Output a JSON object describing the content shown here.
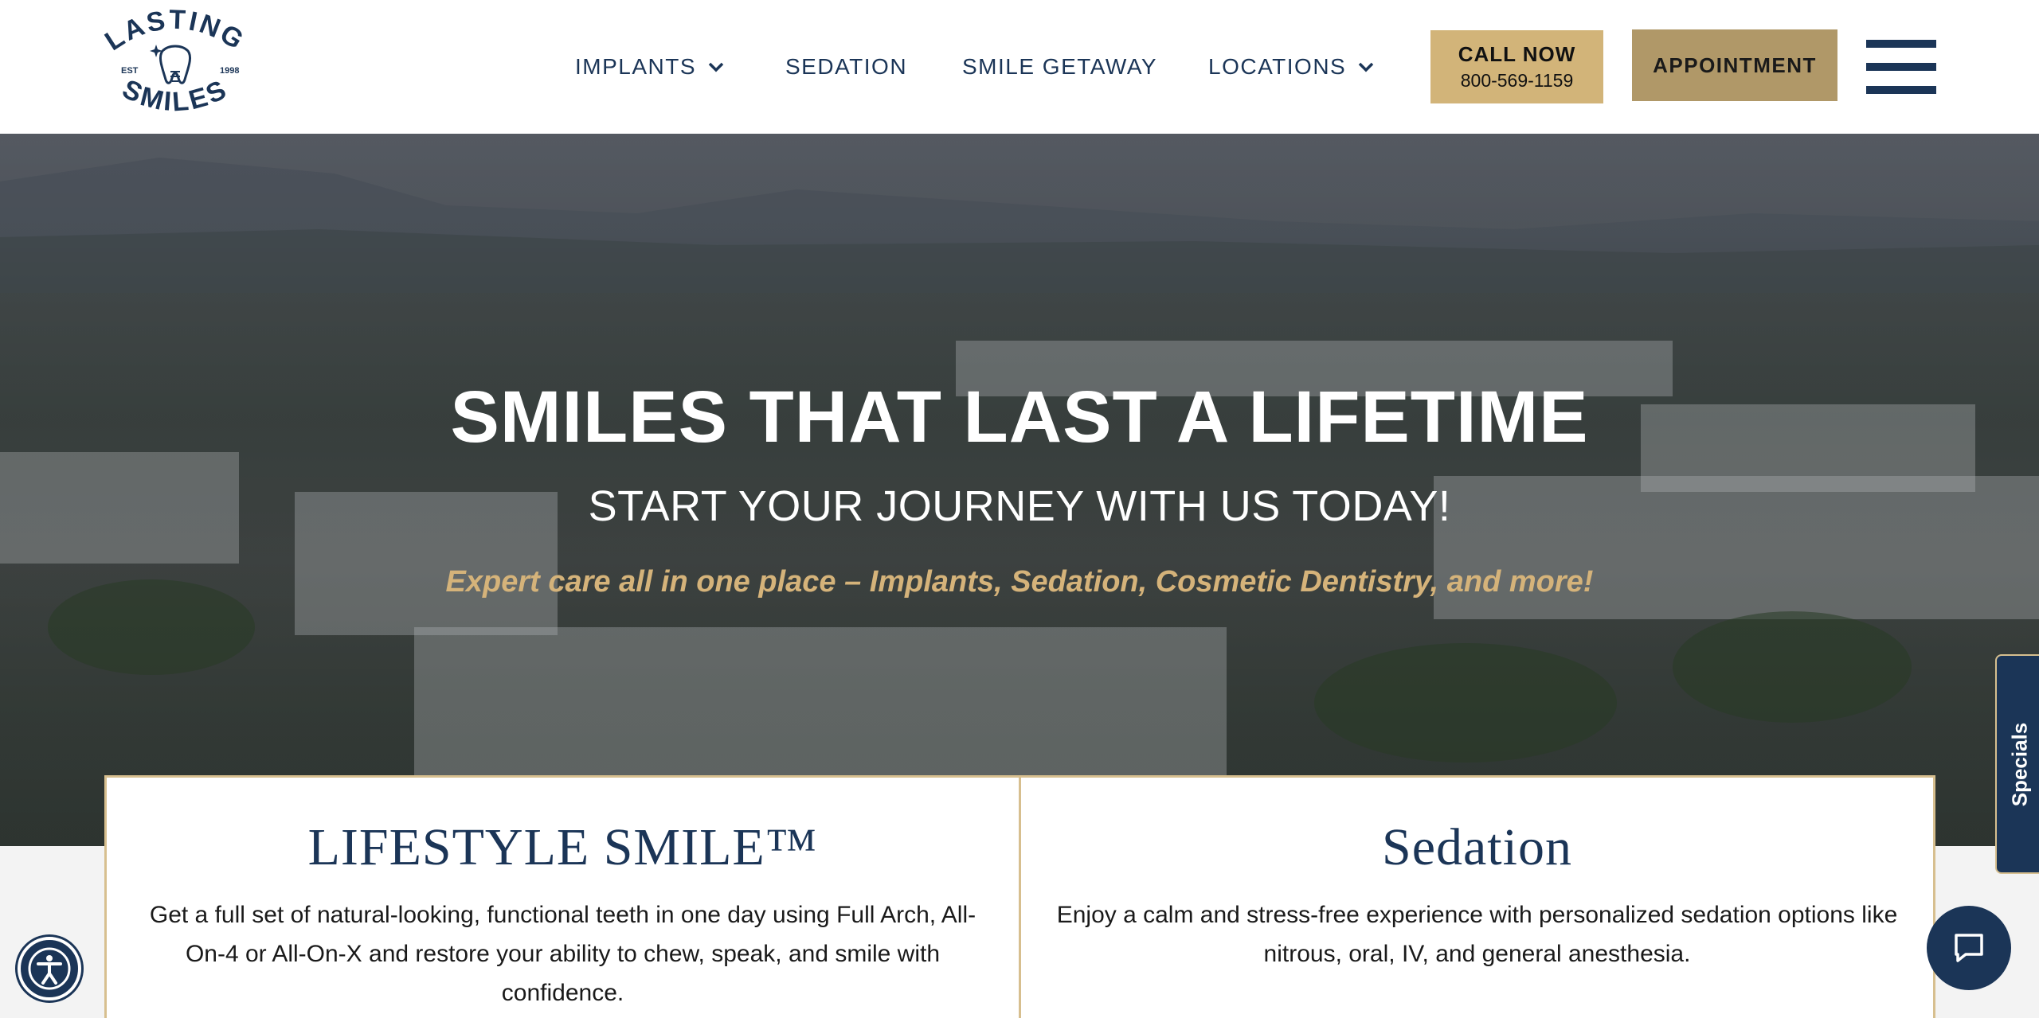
{
  "header": {
    "logo": {
      "top": "LASTING",
      "bottom": "SMILES",
      "est": "EST",
      "year": "1998",
      "icon": "tooth-icon"
    },
    "nav": [
      {
        "label": "IMPLANTS",
        "has_dropdown": true
      },
      {
        "label": "SEDATION",
        "has_dropdown": false
      },
      {
        "label": "SMILE GETAWAY",
        "has_dropdown": false
      },
      {
        "label": "LOCATIONS",
        "has_dropdown": true
      }
    ],
    "call": {
      "label": "CALL NOW",
      "phone": "800-569-1159"
    },
    "appointment_label": "APPOINTMENT",
    "menu_icon": "hamburger-menu-icon"
  },
  "hero": {
    "title": "SMILES THAT LAST A LIFETIME",
    "subtitle": "START YOUR JOURNEY WITH US TODAY!",
    "tagline": "Expert care all in one place – Implants, Sedation, Cosmetic Dentistry, and more!"
  },
  "cards": [
    {
      "title": "LIFESTYLE SMILE™",
      "text": "Get a full set of natural-looking, functional teeth in one day using Full Arch, All-On-4 or All-On-X and restore your ability to chew, speak, and smile with confidence."
    },
    {
      "title": "Sedation",
      "text": "Enjoy a calm and stress-free experience with personalized sedation options like nitrous, oral, IV, and general anesthesia."
    }
  ],
  "specials_label": "Specials",
  "floating": {
    "accessibility_icon": "accessibility-icon",
    "chat_icon": "chat-bubble-icon"
  },
  "colors": {
    "navy": "#1b3557",
    "gold": "#d2b479",
    "gold_dark": "#b09868",
    "tagline": "#d5b37a",
    "border": "#d7bf8f"
  }
}
